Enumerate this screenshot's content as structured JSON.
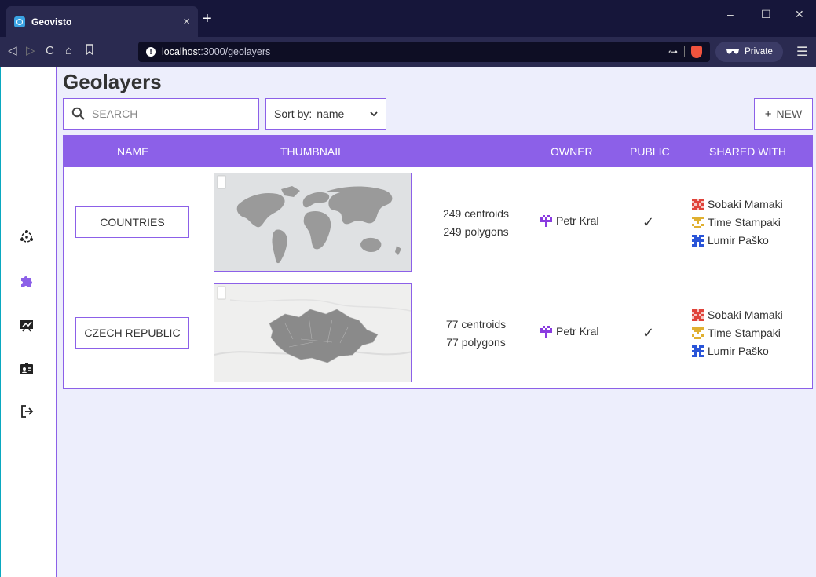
{
  "browser": {
    "tab_title": "Geovisto",
    "tab_close": "×",
    "new_tab": "+",
    "url_host": "localhost",
    "url_path": ":3000/geolayers",
    "private_label": "Private"
  },
  "sidebar": {
    "items": [
      {
        "icon": "network-icon"
      },
      {
        "icon": "puzzle-icon"
      },
      {
        "icon": "chart-icon"
      },
      {
        "icon": "id-card-icon"
      },
      {
        "icon": "logout-icon"
      }
    ]
  },
  "page": {
    "title": "Geolayers",
    "search_placeholder": "SEARCH",
    "sort_label": "Sort by:",
    "sort_value": "name",
    "new_label": "NEW",
    "new_plus": "+"
  },
  "table": {
    "headers": {
      "name": "NAME",
      "thumbnail": "THUMBNAIL",
      "owner": "OWNER",
      "public": "PUBLIC",
      "shared_with": "SHARED WITH"
    },
    "rows": [
      {
        "name": "COUNTRIES",
        "centroids": "249 centroids",
        "polygons": "249 polygons",
        "owner": "Petr Kral",
        "public": "✓",
        "shared": [
          "Sobaki Mamaki",
          "Time Stampaki",
          "Lumir Paško"
        ]
      },
      {
        "name": "CZECH REPUBLIC",
        "centroids": "77 centroids",
        "polygons": "77 polygons",
        "owner": "Petr Kral",
        "public": "✓",
        "shared": [
          "Sobaki Mamaki",
          "Time Stampaki",
          "Lumir Paško"
        ]
      }
    ]
  },
  "colors": {
    "accent": "#8c60e8",
    "page_bg": "#edeefc",
    "owner_avatar": "#8a3be0",
    "avatar_red": "#e0433a",
    "avatar_yellow": "#e0b030",
    "avatar_blue": "#2a55d8"
  }
}
